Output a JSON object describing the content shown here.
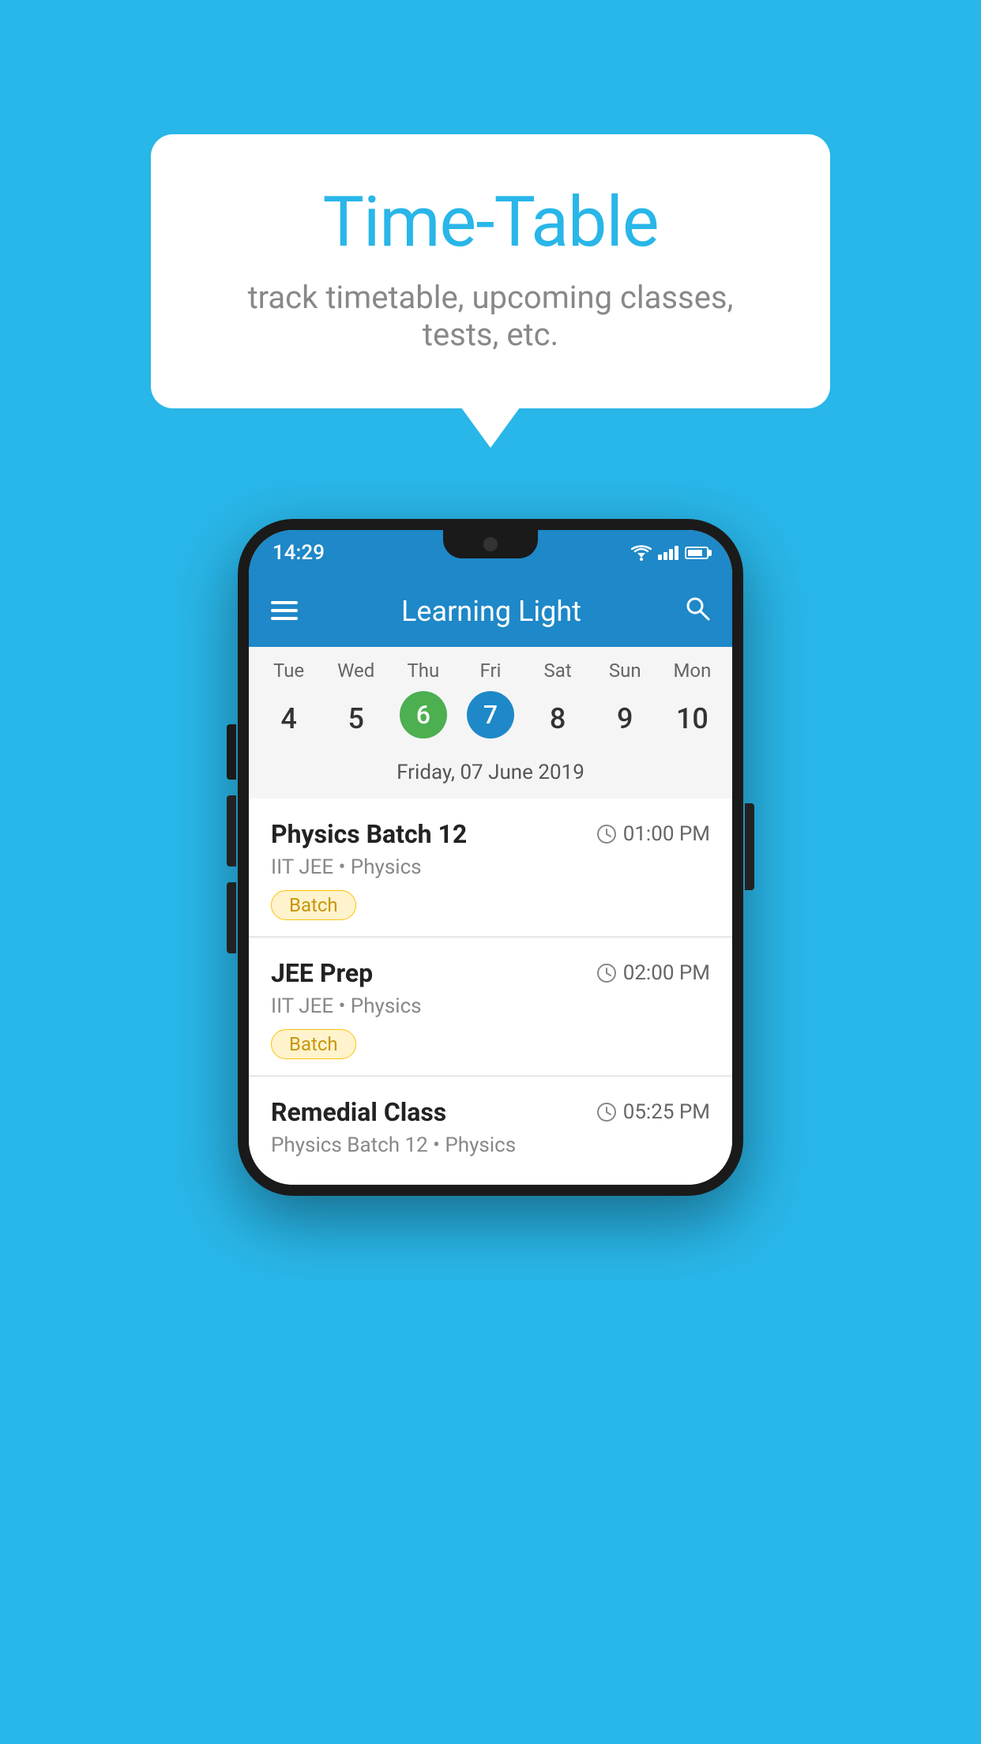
{
  "page": {
    "background_color": "#29b6e8"
  },
  "speech_bubble": {
    "title": "Time-Table",
    "subtitle": "track timetable, upcoming classes, tests, etc."
  },
  "phone": {
    "status_bar": {
      "time": "14:29"
    },
    "app_bar": {
      "title": "Learning Light",
      "menu_icon": "≡",
      "search_icon": "🔍"
    },
    "calendar": {
      "days": [
        "Tue",
        "Wed",
        "Thu",
        "Fri",
        "Sat",
        "Sun",
        "Mon"
      ],
      "dates": [
        "4",
        "5",
        "6",
        "7",
        "8",
        "9",
        "10"
      ],
      "today_index": 2,
      "selected_index": 3,
      "selected_label": "Friday, 07 June 2019"
    },
    "schedule": [
      {
        "title": "Physics Batch 12",
        "time": "01:00 PM",
        "subtitle": "IIT JEE • Physics",
        "badge": "Batch"
      },
      {
        "title": "JEE Prep",
        "time": "02:00 PM",
        "subtitle": "IIT JEE • Physics",
        "badge": "Batch"
      },
      {
        "title": "Remedial Class",
        "time": "05:25 PM",
        "subtitle": "Physics Batch 12 • Physics",
        "badge": null
      }
    ]
  }
}
